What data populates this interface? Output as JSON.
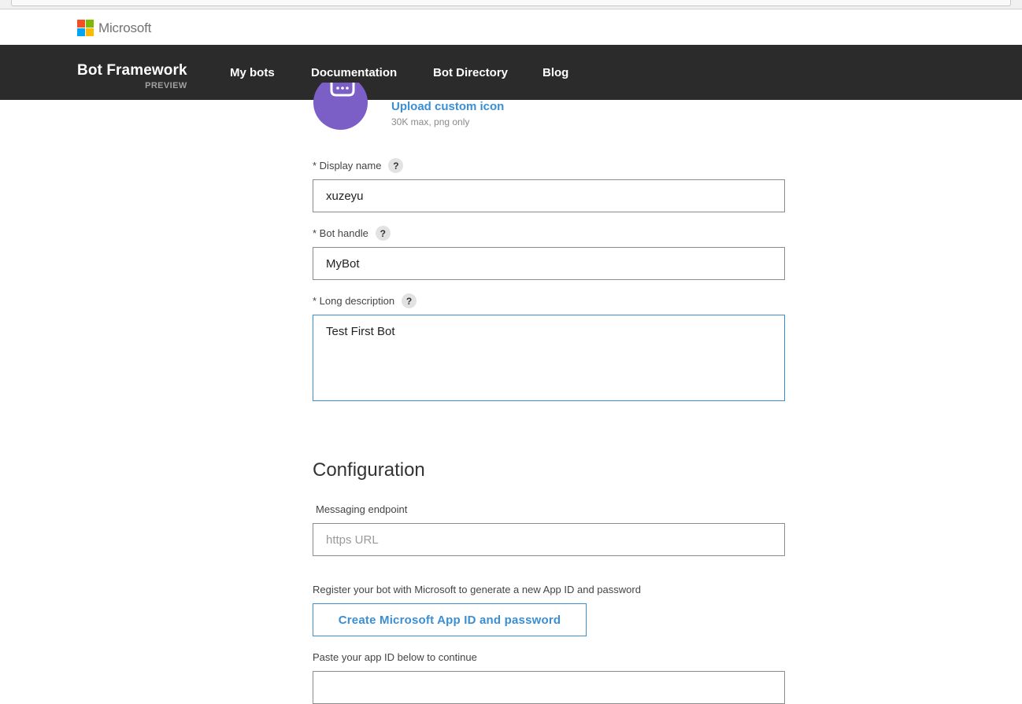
{
  "ms_header": {
    "brand": "Microsoft",
    "logo_colors": [
      "#f25022",
      "#7fba00",
      "#00a4ef",
      "#ffb900"
    ]
  },
  "navbar": {
    "title": "Bot Framework",
    "subtitle": "PREVIEW",
    "items": [
      {
        "label": "My bots"
      },
      {
        "label": "Documentation"
      },
      {
        "label": "Bot Directory"
      },
      {
        "label": "Blog"
      }
    ],
    "background": "#2b2b2b"
  },
  "icon_section": {
    "upload_label": "Upload custom icon",
    "hint": "30K max, png only",
    "icon_color": "#7b5ec6"
  },
  "profile": {
    "display_name": {
      "label": "* Display name",
      "help": "?",
      "value": "xuzeyu"
    },
    "bot_handle": {
      "label": "* Bot handle",
      "help": "?",
      "value": "MyBot"
    },
    "long_description": {
      "label": "* Long description",
      "help": "?",
      "value": "Test First Bot"
    }
  },
  "configuration": {
    "title": "Configuration",
    "endpoint_label": "Messaging endpoint",
    "endpoint_value": "",
    "endpoint_placeholder": "https URL",
    "register_text": "Register your bot with Microsoft to generate a new App ID and password",
    "create_button": "Create Microsoft App ID and password",
    "paste_text": "Paste your app ID below to continue"
  },
  "colors": {
    "accent": "#3a8ed4"
  }
}
